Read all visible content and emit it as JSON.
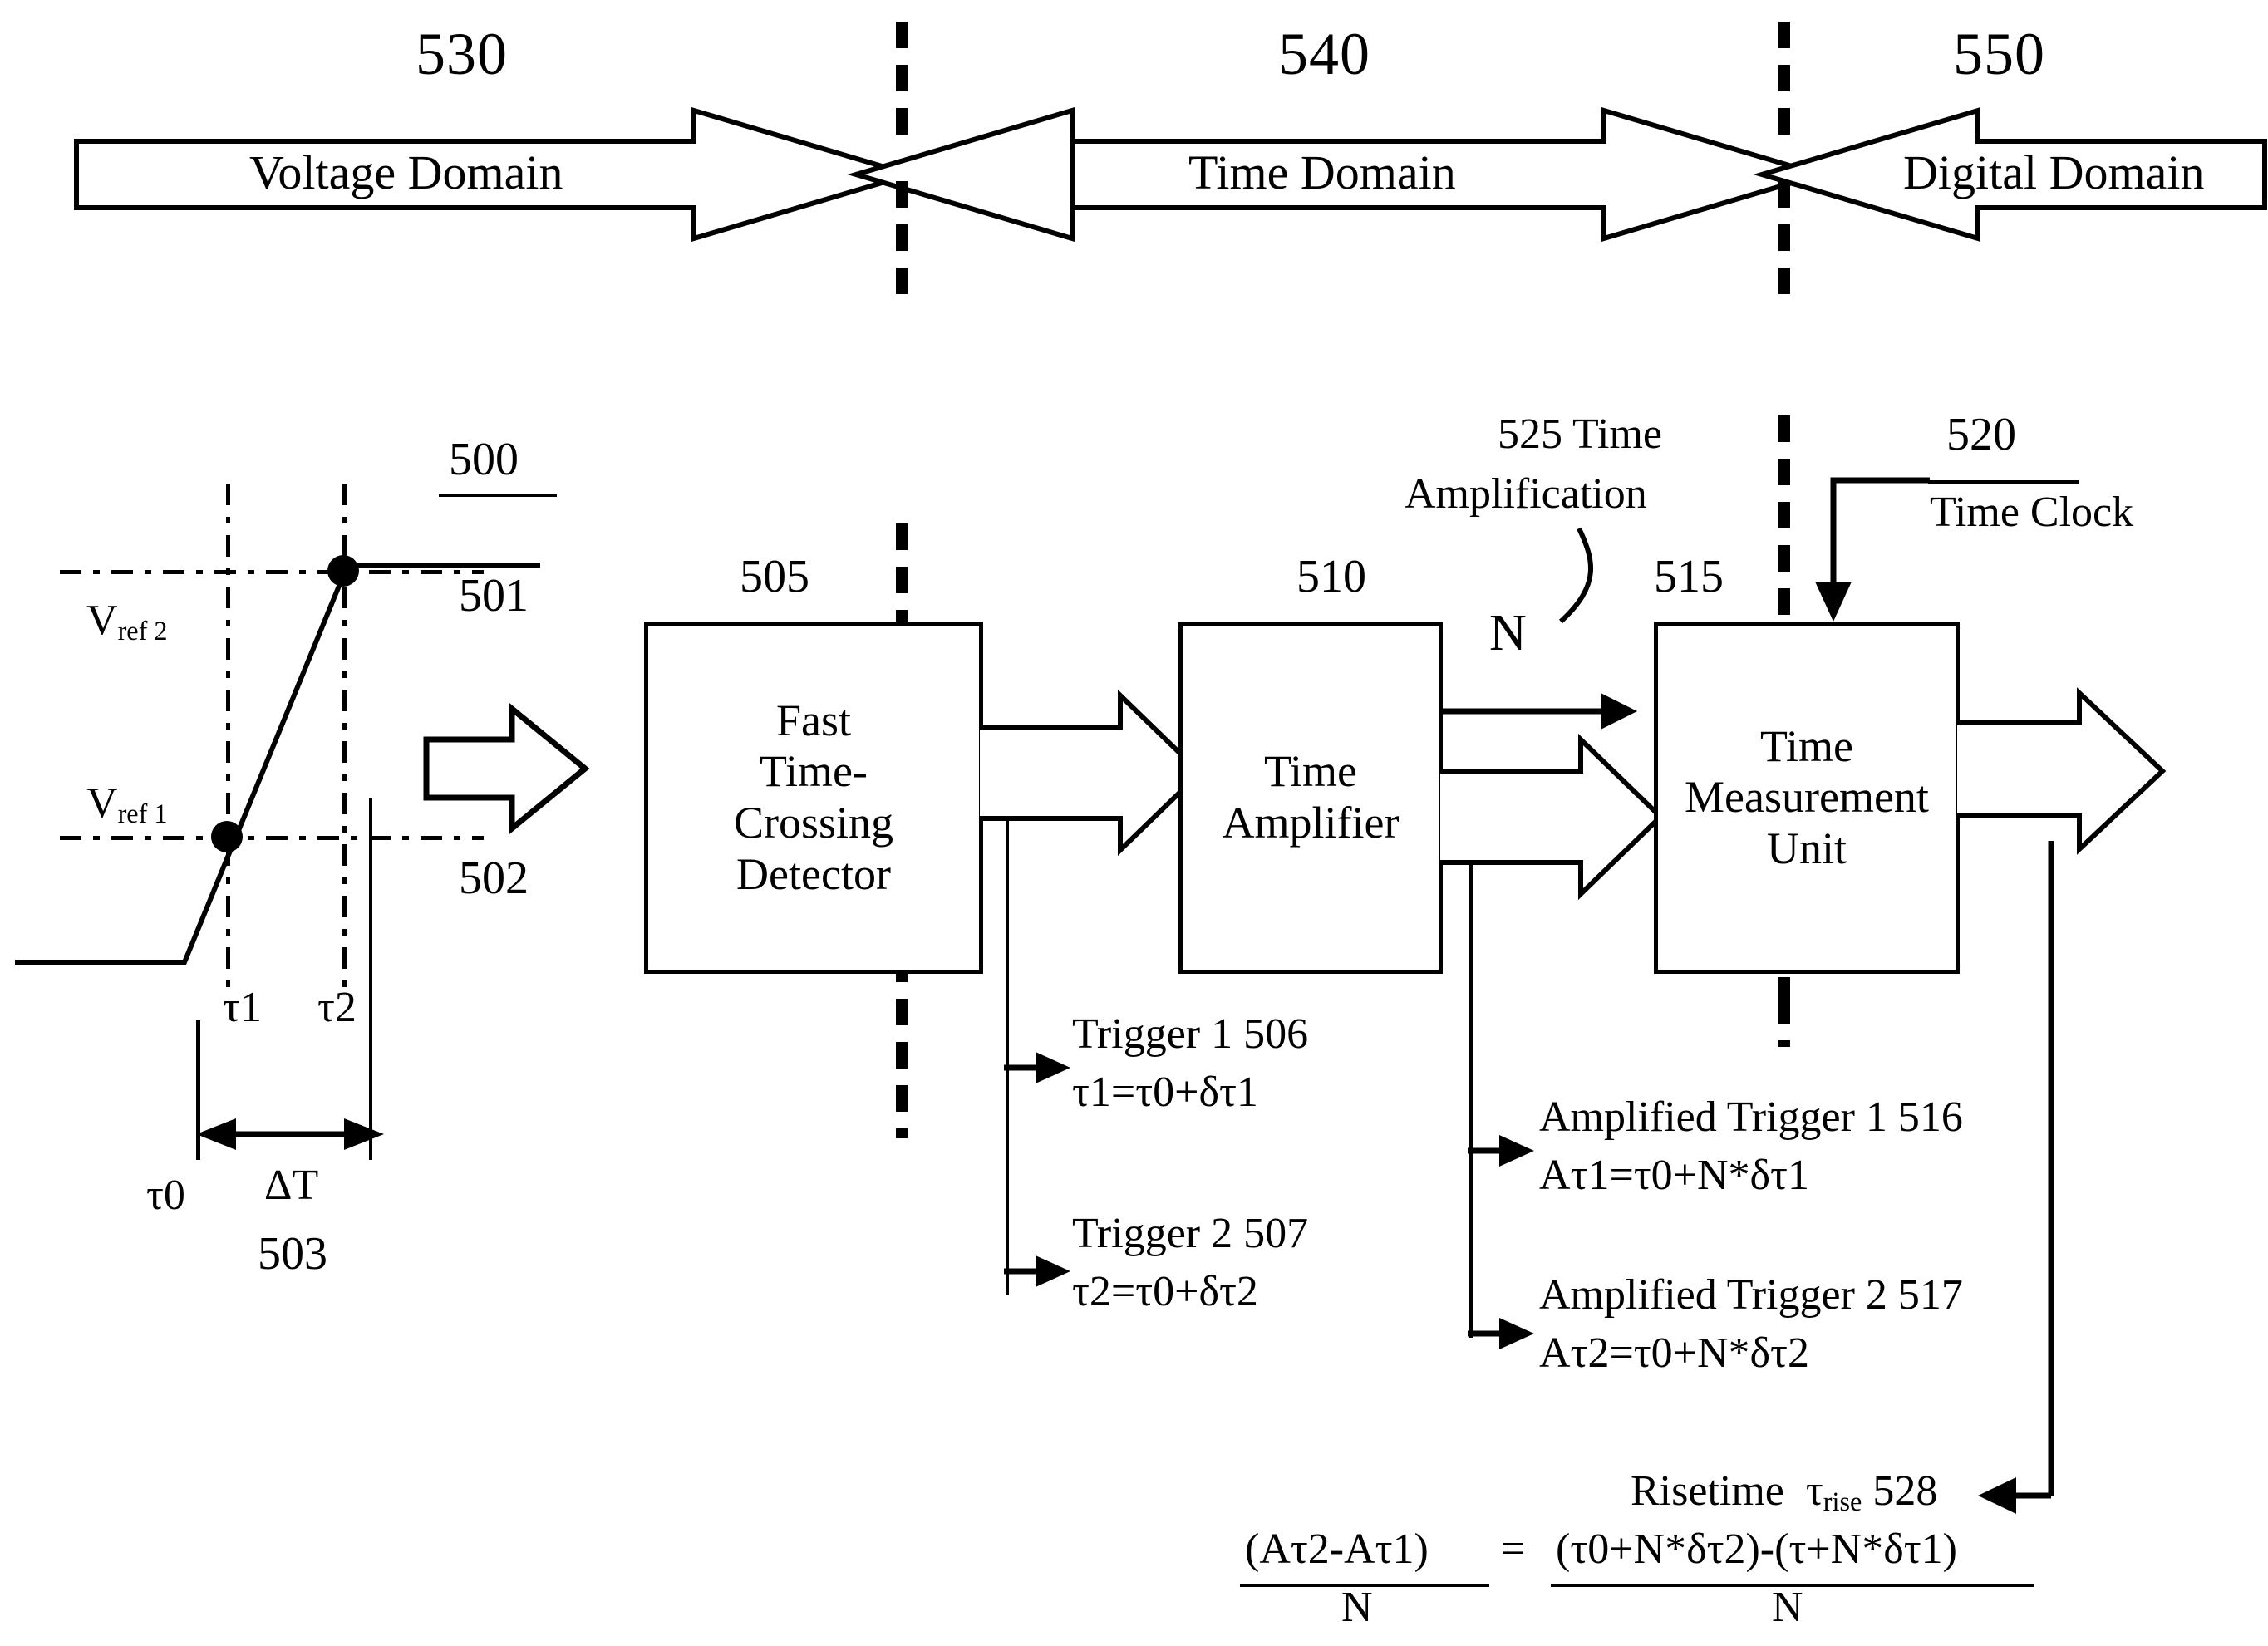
{
  "figure": {
    "domains": [
      {
        "ref": "530",
        "label": "Voltage Domain"
      },
      {
        "ref": "540",
        "label": "Time Domain"
      },
      {
        "ref": "550",
        "label": "Digital Domain"
      }
    ],
    "waveform": {
      "signal_ref": "500",
      "upper_crossing_ref": "501",
      "lower_crossing_ref": "502",
      "interval_ref": "503",
      "vref2_label": "V",
      "vref2_sub": "ref 2",
      "vref1_label": "V",
      "vref1_sub": "ref 1",
      "tau0": "τ0",
      "tau1": "τ1",
      "tau2": "τ2",
      "delta_t": "ΔT"
    },
    "blocks": [
      {
        "ref": "505",
        "lines": [
          "Fast",
          "Time-",
          "Crossing",
          "Detector"
        ]
      },
      {
        "ref": "510",
        "lines": [
          "Time",
          "Amplifier"
        ]
      },
      {
        "ref": "515",
        "lines": [
          "Time",
          "Measurement",
          "Unit"
        ]
      }
    ],
    "annotations": {
      "time_amplification_ref": "525",
      "time_amplification_label": "525 Time",
      "time_amplification_label2": "Amplification",
      "gain_symbol": "N",
      "time_clock_ref": "520",
      "time_clock_label": "Time Clock"
    },
    "triggers": [
      {
        "title": "Trigger 1  506",
        "equation": "τ1=τ0+δτ1"
      },
      {
        "title": "Trigger 2  507",
        "equation": "τ2=τ0+δτ2"
      }
    ],
    "amplified_triggers": [
      {
        "title": "Amplified Trigger 1  516",
        "equation": "Aτ1=τ0+N*δτ1"
      },
      {
        "title": "Amplified Trigger 2  517",
        "equation": "Aτ2=τ0+N*δτ2"
      }
    ],
    "result": {
      "risetime_text": "Risetime",
      "risetime_symbol": "τ",
      "risetime_sub": "rise",
      "risetime_ref": "528",
      "lhs_numerator": "(Aτ2-Aτ1)",
      "lhs_denominator": "N",
      "equals": "=",
      "rhs_numerator": "(τ0+N*δτ2)-(τ+N*δτ1)",
      "rhs_denominator": "N"
    }
  }
}
